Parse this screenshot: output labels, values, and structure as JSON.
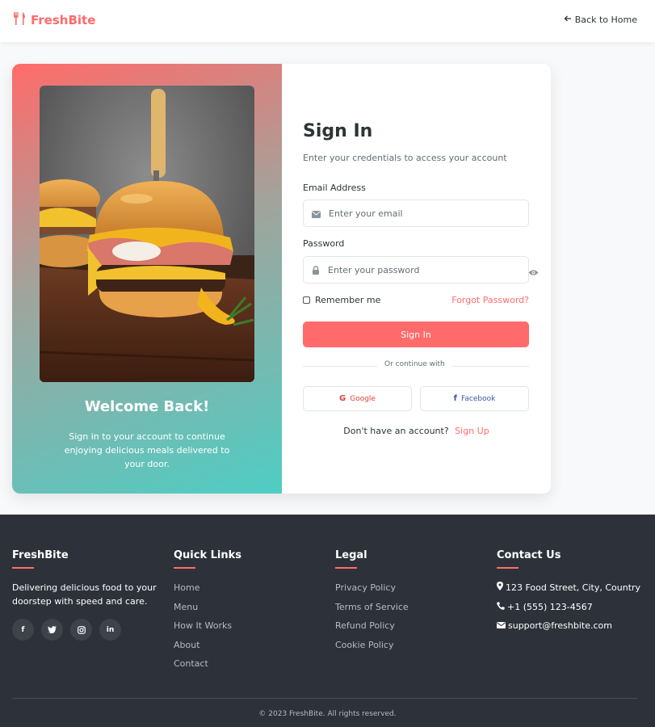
{
  "header": {
    "brand": "FreshBite",
    "back_link": "Back to Home"
  },
  "hero": {
    "welcome_title": "Welcome Back!",
    "welcome_text": "Sign in to your account to continue enjoying delicious meals delivered to your door."
  },
  "form": {
    "title": "Sign In",
    "subtitle": "Enter your credentials to access your account",
    "email_label": "Email Address",
    "email_placeholder": "Enter your email",
    "password_label": "Password",
    "password_placeholder": "Enter your password",
    "remember_label": "Remember me",
    "forgot_label": "Forgot Password?",
    "submit_label": "Sign In",
    "divider_label": "Or continue with",
    "google_label": "Google",
    "facebook_label": "Facebook",
    "signup_prompt": "Don't have an account?",
    "signup_link": "Sign Up"
  },
  "footer": {
    "brand": "FreshBite",
    "description": "Delivering delicious food to your doorstep with speed and care.",
    "social_icons": [
      "facebook-icon",
      "twitter-icon",
      "instagram-icon",
      "linkedin-icon"
    ],
    "quick_links_title": "Quick Links",
    "quick_links": [
      "Home",
      "Menu",
      "How It Works",
      "About",
      "Contact"
    ],
    "legal_title": "Legal",
    "legal_links": [
      "Privacy Policy",
      "Terms of Service",
      "Refund Policy",
      "Cookie Policy"
    ],
    "contact_title": "Contact Us",
    "address": "123 Food Street, City, Country",
    "phone": "+1 (555) 123-4567",
    "email": "support@freshbite.com",
    "copyright": "© 2023 FreshBite. All rights reserved."
  },
  "colors": {
    "accent": "#ff6b6b",
    "teal": "#4ecdc4",
    "dark": "#2d3436",
    "footer_bg": "#2d3139"
  }
}
